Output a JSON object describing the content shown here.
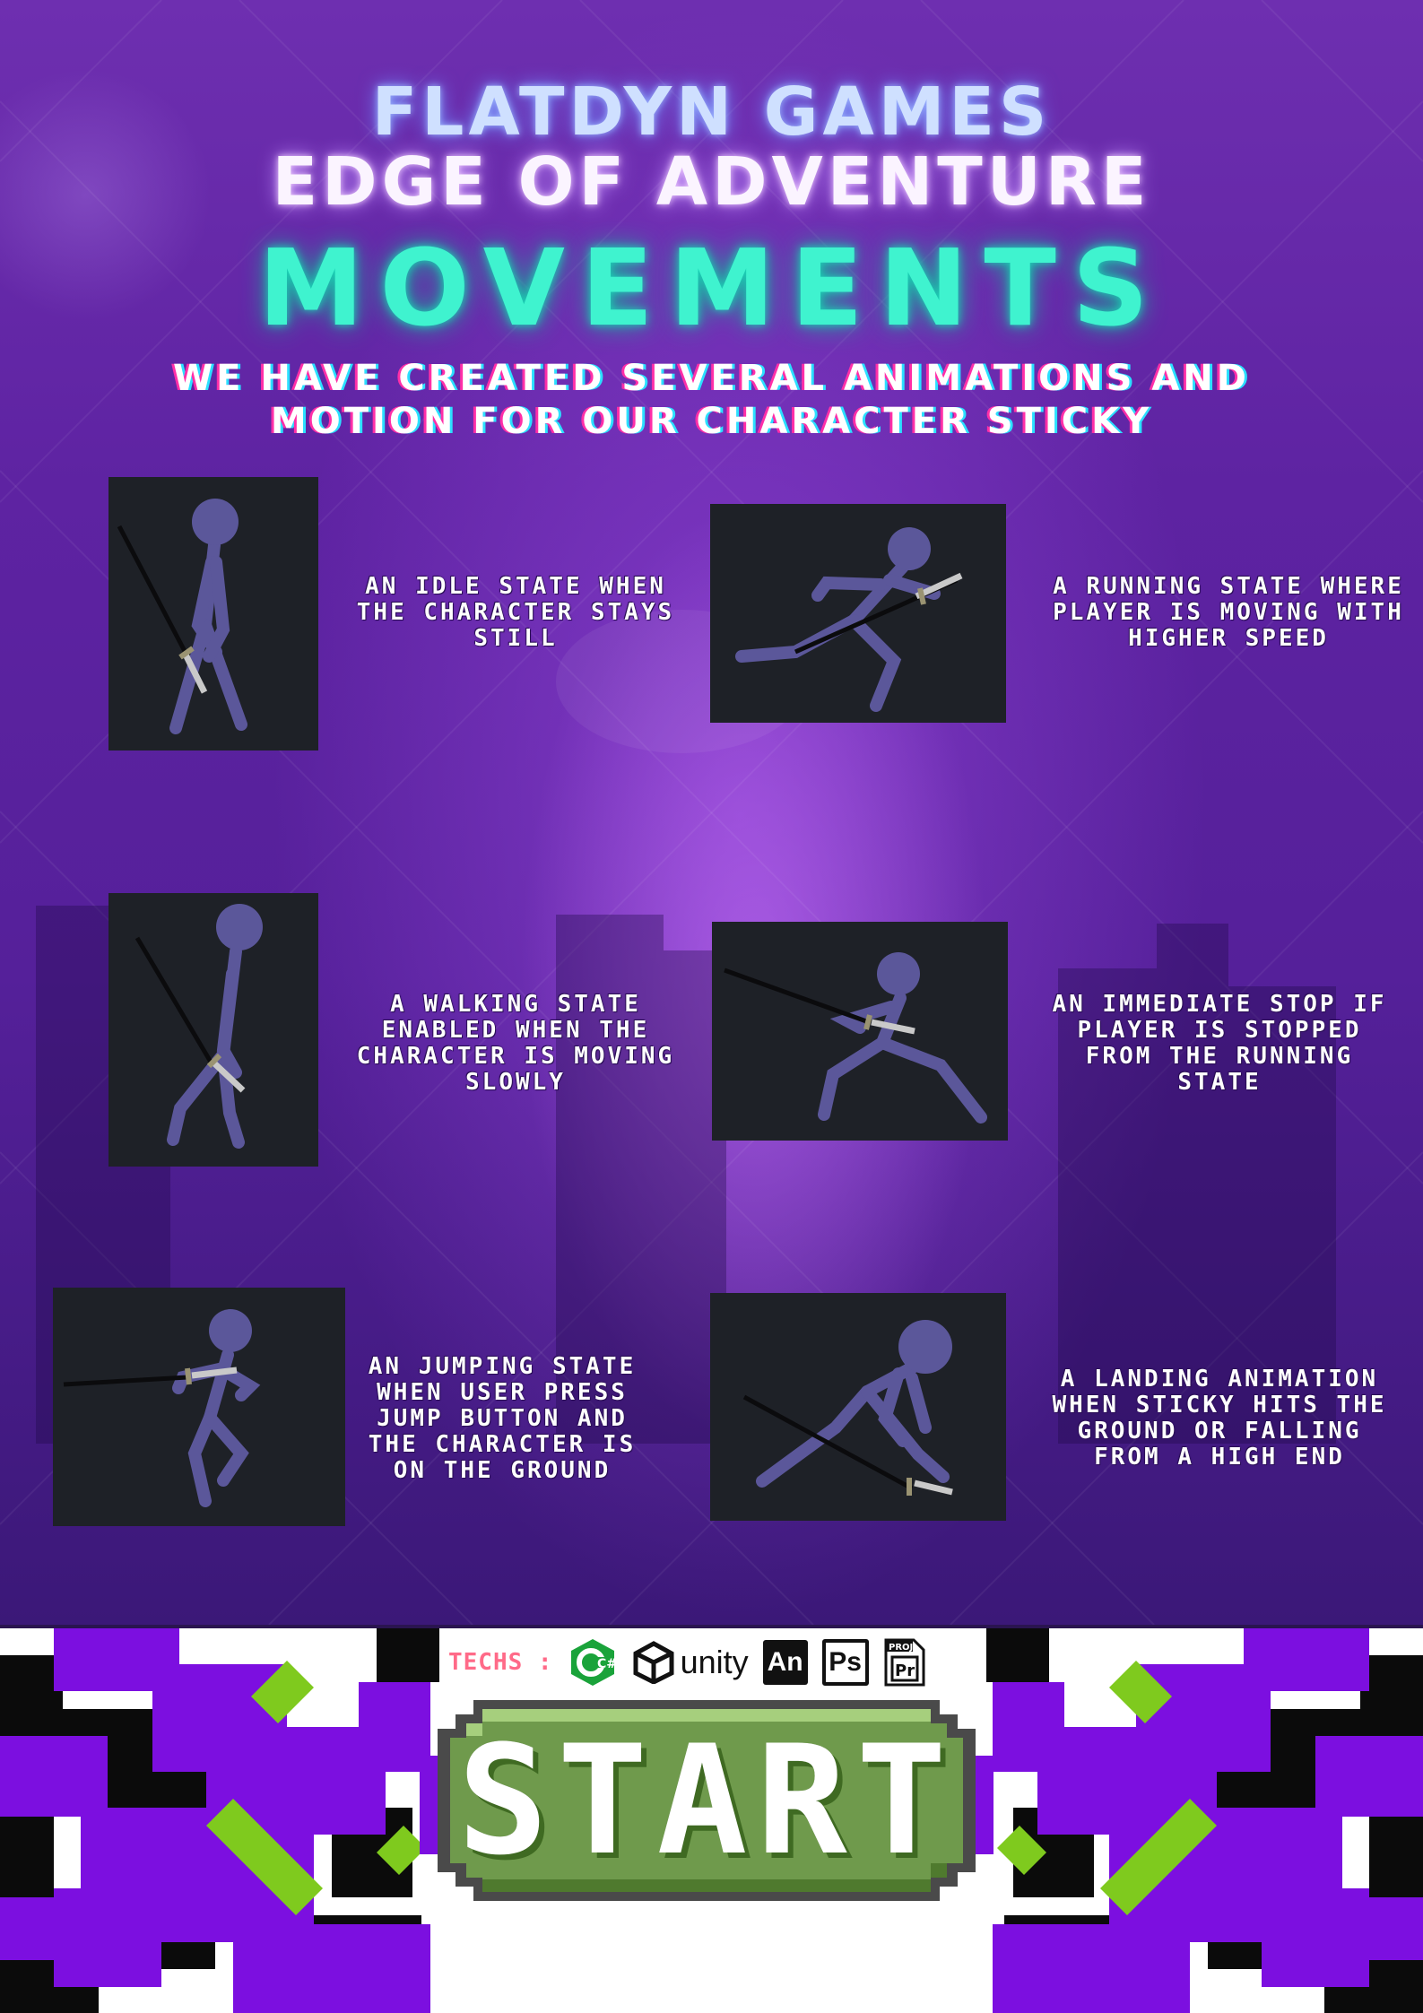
{
  "header": {
    "studio": "FLATDYN GAMES",
    "game": "EDGE OF ADVENTURE",
    "section": "MOVEMENTS",
    "subtitle_line1": "WE HAVE CREATED SEVERAL ANIMATIONS AND",
    "subtitle_line2": "MOTION FOR OUR CHARACTER STICKY"
  },
  "animations": [
    {
      "state": "idle",
      "caption": "AN IDLE STATE WHEN\nTHE CHARACTER STAYS\nSTILL"
    },
    {
      "state": "running",
      "caption": "A RUNNING STATE WHERE\nPLAYER IS MOVING WITH\nHIGHER SPEED"
    },
    {
      "state": "walking",
      "caption": "A WALKING STATE\nENABLED WHEN THE\nCHARACTER IS MOVING\nSLOWLY"
    },
    {
      "state": "stop",
      "caption": "AN IMMEDIATE STOP IF\nPLAYER IS STOPPED\nFROM THE RUNNING\nSTATE"
    },
    {
      "state": "jumping",
      "caption": "AN JUMPING STATE\nWHEN USER PRESS\nJUMP BUTTON AND\nTHE CHARACTER IS\nON THE GROUND"
    },
    {
      "state": "landing",
      "caption": "A LANDING ANIMATION\nWHEN STICKY HITS THE\nGROUND OR FALLING\nFROM A HIGH END"
    }
  ],
  "techs": {
    "label": "TECHS :",
    "csharp": "C#",
    "unity": "unity",
    "animate": "An",
    "photoshop": "Ps",
    "proj_tag": "PROJ",
    "premiere": "Pr"
  },
  "start_button": {
    "label": "START"
  },
  "colors": {
    "panel_purple": "#5e23a2",
    "neon_teal": "#3ff3cf",
    "frame_dark": "#1e2127",
    "stick_figure": "#5b579a",
    "pixel_purple": "#7c0fe0",
    "pixel_green": "#7fca1e",
    "button_green": "#6f9a4c",
    "techs_label": "#ff6a88"
  }
}
